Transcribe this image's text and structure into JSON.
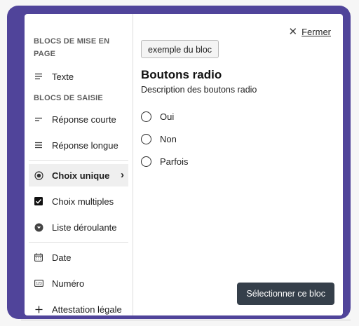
{
  "sidebar": {
    "sections": [
      {
        "title": "BLOCS DE MISE EN PAGE"
      },
      {
        "title": "BLOCS DE SAISIE"
      }
    ],
    "items": [
      {
        "label": "Texte",
        "icon": "text-lines-icon"
      },
      {
        "label": "Réponse courte",
        "icon": "short-lines-icon"
      },
      {
        "label": "Réponse longue",
        "icon": "long-lines-icon"
      },
      {
        "label": "Choix unique",
        "icon": "radio-icon",
        "active": true
      },
      {
        "label": "Choix multiples",
        "icon": "checkbox-icon"
      },
      {
        "label": "Liste déroulante",
        "icon": "dropdown-icon"
      },
      {
        "label": "Date",
        "icon": "calendar-icon"
      },
      {
        "label": "Numéro",
        "icon": "number-icon"
      },
      {
        "label": "Attestation légale",
        "icon": "plus-icon"
      }
    ]
  },
  "close": {
    "label": "Fermer",
    "icon": "close-icon"
  },
  "content": {
    "example_label": "exemple du bloc",
    "title": "Boutons radio",
    "description": "Description des boutons radio",
    "options": [
      "Oui",
      "Non",
      "Parfois"
    ],
    "select_label": "Sélectionner ce bloc"
  },
  "colors": {
    "frame": "#50449a",
    "select_button": "#353f4a",
    "active_item_bg": "#efefef"
  }
}
